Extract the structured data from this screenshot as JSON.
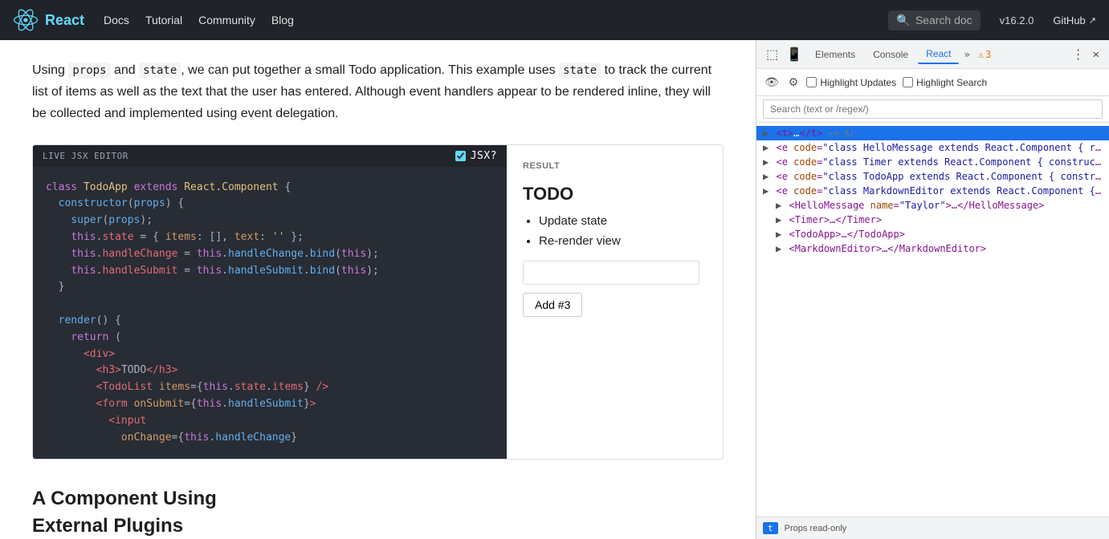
{
  "nav": {
    "logo_text": "React",
    "links": [
      "Docs",
      "Tutorial",
      "Community",
      "Blog"
    ],
    "search_placeholder": "Search doc",
    "version": "v16.2.0",
    "github": "GitHub"
  },
  "content": {
    "paragraph1_parts": [
      "Using ",
      "props",
      " and ",
      "state",
      ", we can put together a small Todo application. This example uses ",
      "state",
      " to track the current list of items as well as the text that the user has entered. Although event handlers appear to be rendered inline, they will be collected and implemented using event delegation."
    ],
    "editor": {
      "header_label": "LIVE JSX EDITOR",
      "jsx_label": "JSX?",
      "code": "class TodoApp extends React.Component {\n  constructor(props) {\n    super(props);\n    this.state = { items: [], text: '' };\n    this.handleChange = this.handleChange.bind(this);\n    this.handleSubmit = this.handleSubmit.bind(this);\n  }\n\n  render() {\n    return (\n      <div>\n        <h3>TODO</h3>\n        <TodoList items={this.state.items} />\n        <form onSubmit={this.handleSubmit}>\n          <input\n            onChange={this.handleChange}"
    },
    "result": {
      "header_label": "RESULT",
      "todo_title": "TODO",
      "todo_items": [
        "Update state",
        "Re-render view"
      ],
      "add_button": "Add #3"
    },
    "footer_heading_line1": "A Component Using",
    "footer_heading_line2": "External Plugins"
  },
  "devtools": {
    "tabs": [
      "Elements",
      "Console",
      "React"
    ],
    "more_label": "»",
    "alert_count": "3",
    "toolbar": {
      "highlight_updates_label": "Highlight Updates",
      "highlight_search_label": "Highlight Search"
    },
    "search_placeholder": "Search (text or /regex/)",
    "tree": [
      {
        "id": "t-node",
        "label": "<t>…</t>",
        "suffix": "== $r",
        "selected": true,
        "indent": 0
      },
      {
        "id": "e-hello",
        "label": "<e code=\"class HelloMessage extends React.Component { ren…\"",
        "selected": false,
        "indent": 0
      },
      {
        "id": "e-timer",
        "label": "<e code=\"class Timer extends React.Component { constructo…\"",
        "selected": false,
        "indent": 0
      },
      {
        "id": "e-todo",
        "label": "<e code=\"class TodoApp extends React.Component { construc…\"",
        "selected": false,
        "indent": 0
      },
      {
        "id": "e-markdown",
        "label": "<e code=\"class MarkdownEditor extends React.Component { c…\"",
        "selected": false,
        "indent": 0
      },
      {
        "id": "hello-msg",
        "label": "<HelloMessage name=\"Taylor\">…</HelloMessage>",
        "selected": false,
        "indent": 1
      },
      {
        "id": "timer",
        "label": "<Timer>…</Timer>",
        "selected": false,
        "indent": 1
      },
      {
        "id": "todoapp",
        "label": "<TodoApp>…</TodoApp>",
        "selected": false,
        "indent": 1
      },
      {
        "id": "markdown-editor",
        "label": "<MarkdownEditor>…</MarkdownEditor>",
        "selected": false,
        "indent": 1
      }
    ],
    "bottom": {
      "tag": "t",
      "props_label": "Props  read-only"
    }
  }
}
